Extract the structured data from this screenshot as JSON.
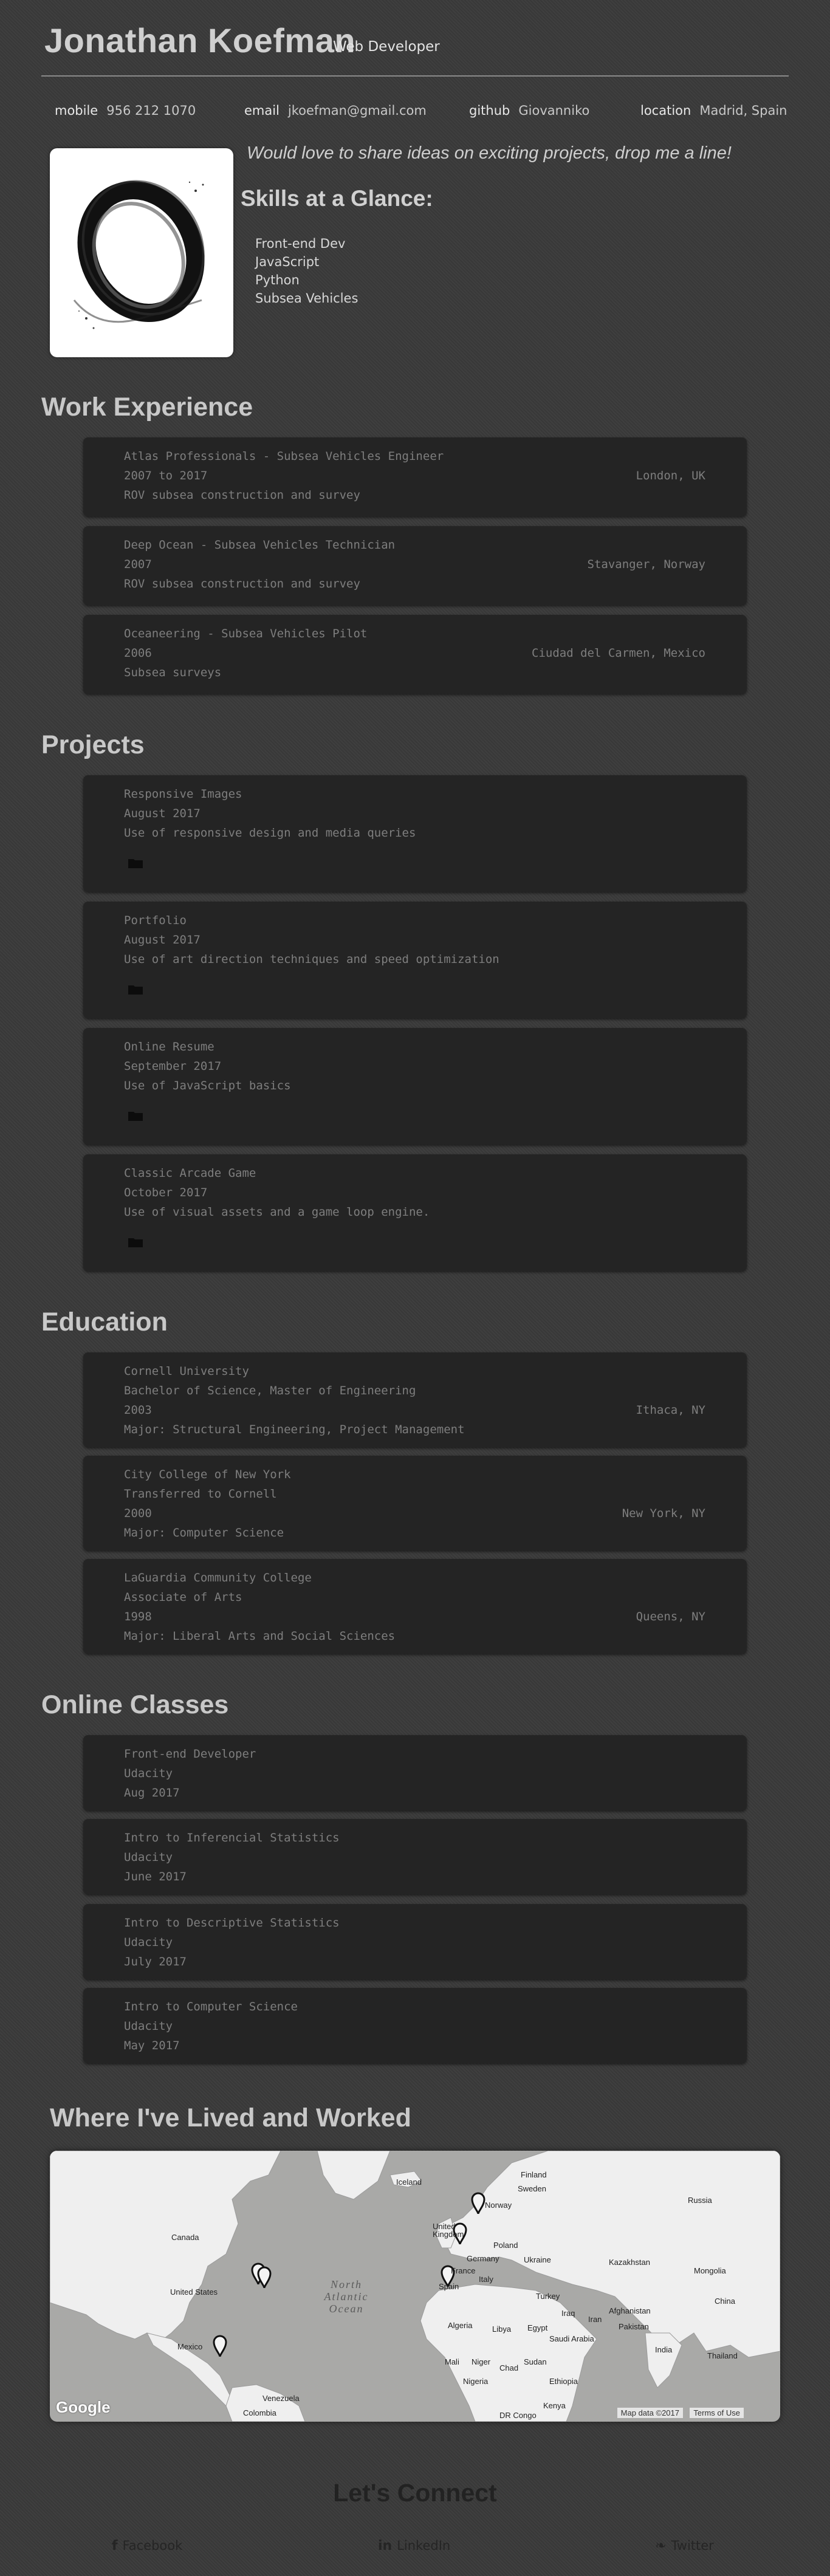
{
  "header": {
    "name": "Jonathan Koefman",
    "role": "Web Developer"
  },
  "contacts": [
    {
      "label": "mobile",
      "value": "956 212 1070"
    },
    {
      "label": "email",
      "value": "jkoefman@gmail.com"
    },
    {
      "label": "github",
      "value": "Giovanniko"
    },
    {
      "label": "location",
      "value": "Madrid, Spain"
    }
  ],
  "bio": {
    "welcome": "Would love to share ideas on exciting projects, drop me a line!",
    "skills_heading": "Skills at a Glance:",
    "skills": [
      "Front-end Dev",
      "JavaScript",
      "Python",
      "Subsea Vehicles"
    ]
  },
  "work": {
    "heading": "Work Experience",
    "jobs": [
      {
        "title": "Atlas Professionals - Subsea Vehicles Engineer",
        "dates": "2007 to 2017",
        "location": "London, UK",
        "description": "ROV subsea construction and survey"
      },
      {
        "title": "Deep Ocean - Subsea Vehicles Technician",
        "dates": "2007",
        "location": "Stavanger, Norway",
        "description": "ROV subsea construction and survey"
      },
      {
        "title": "Oceaneering - Subsea Vehicles Pilot",
        "dates": "2006",
        "location": "Ciudad del Carmen, Mexico",
        "description": "Subsea surveys"
      }
    ]
  },
  "projects": {
    "heading": "Projects",
    "items": [
      {
        "title": "Responsive Images",
        "dates": "August 2017",
        "description": "Use of responsive design and media queries"
      },
      {
        "title": "Portfolio",
        "dates": "August 2017",
        "description": "Use of art direction techniques and speed optimization"
      },
      {
        "title": "Online Resume",
        "dates": "September 2017",
        "description": "Use of JavaScript basics"
      },
      {
        "title": "Classic Arcade Game",
        "dates": "October 2017",
        "description": "Use of visual assets and a game loop engine."
      }
    ]
  },
  "education": {
    "heading": "Education",
    "schools": [
      {
        "name": "Cornell University",
        "degree": "Bachelor of Science, Master of Engineering",
        "dates": "2003",
        "location": "Ithaca, NY",
        "major": "Major: Structural Engineering, Project Management"
      },
      {
        "name": "City College of New York",
        "degree": "Transferred to Cornell",
        "dates": "2000",
        "location": "New York, NY",
        "major": "Major: Computer Science"
      },
      {
        "name": "LaGuardia Community College",
        "degree": "Associate of Arts",
        "dates": "1998",
        "location": "Queens, NY",
        "major": "Major: Liberal Arts and Social Sciences"
      }
    ]
  },
  "online": {
    "heading": "Online Classes",
    "classes": [
      {
        "title": "Front-end Developer",
        "school": "Udacity",
        "dates": "Aug 2017"
      },
      {
        "title": "Intro to Inferencial Statistics",
        "school": "Udacity",
        "dates": "June 2017"
      },
      {
        "title": "Intro to Descriptive Statistics",
        "school": "Udacity",
        "dates": "July 2017"
      },
      {
        "title": "Intro to Computer Science",
        "school": "Udacity",
        "dates": "May 2017"
      }
    ]
  },
  "map": {
    "heading": "Where I've Lived and Worked",
    "labels": {
      "canada": "Canada",
      "united_states": "United States",
      "mexico": "Mexico",
      "venezuela": "Venezuela",
      "colombia": "Colombia",
      "iceland": "Iceland",
      "sweden": "Sweden",
      "norway": "Norway",
      "finland": "Finland",
      "russia": "Russia",
      "uk": "United Kingdom",
      "poland": "Poland",
      "germany": "Germany",
      "ukraine": "Ukraine",
      "france": "France",
      "kazakhstan": "Kazakhstan",
      "mongolia": "Mongolia",
      "spain": "Spain",
      "italy": "Italy",
      "turkey": "Turkey",
      "afghanistan": "Afghanistan",
      "iraq": "Iraq",
      "iran": "Iran",
      "china": "China",
      "pakistan": "Pakistan",
      "algeria": "Algeria",
      "libya": "Libya",
      "egypt": "Egypt",
      "saudi": "Saudi Arabia",
      "india": "India",
      "thailand": "Thailand",
      "mali": "Mali",
      "niger": "Niger",
      "chad": "Chad",
      "sudan": "Sudan",
      "nigeria": "Nigeria",
      "ethiopia": "Ethiopia",
      "drc": "DR Congo",
      "kenya": "Kenya",
      "ocean": "North Atlantic Ocean"
    },
    "attribution": "Google",
    "map_data": "Map data ©2017",
    "terms": "Terms of Use"
  },
  "footer": {
    "heading": "Let's Connect",
    "links": [
      {
        "icon": "facebook-icon",
        "glyph": "f",
        "label": "Facebook"
      },
      {
        "icon": "linkedin-icon",
        "glyph": "in",
        "label": "LinkedIn"
      },
      {
        "icon": "twitter-icon",
        "glyph": "❧",
        "label": "Twitter"
      }
    ]
  }
}
